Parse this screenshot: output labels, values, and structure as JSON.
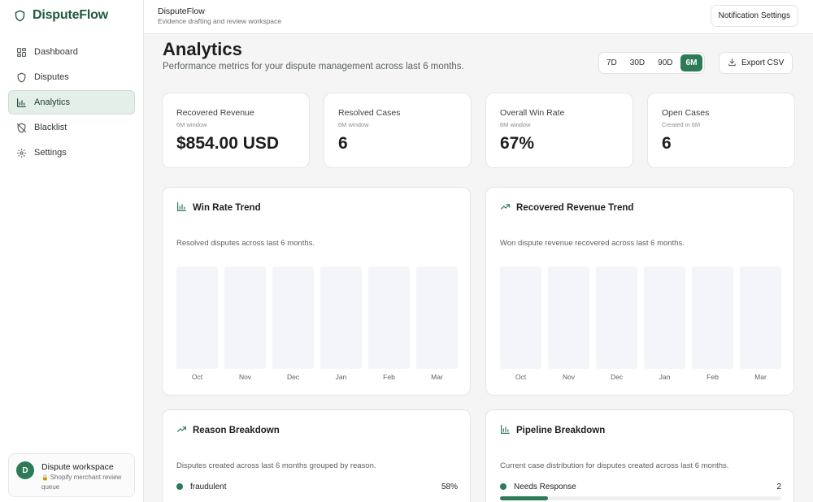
{
  "brand": {
    "name": "DisputeFlow"
  },
  "sidebar": {
    "items": [
      {
        "label": "Dashboard",
        "icon": "dashboard-icon",
        "active": false
      },
      {
        "label": "Disputes",
        "icon": "shield-icon",
        "active": false
      },
      {
        "label": "Analytics",
        "icon": "bar-chart-icon",
        "active": true
      },
      {
        "label": "Blacklist",
        "icon": "shield-off-icon",
        "active": false
      },
      {
        "label": "Settings",
        "icon": "gear-icon",
        "active": false
      }
    ],
    "workspace": {
      "avatar": "D",
      "name": "Dispute workspace",
      "subtitle": "Shopify merchant review queue"
    }
  },
  "topbar": {
    "title": "DisputeFlow",
    "subtitle": "Evidence drafting and review workspace",
    "notification_button": "Notification Settings"
  },
  "header": {
    "title": "Analytics",
    "subtitle": "Performance metrics for your dispute management across last 6 months.",
    "ranges": [
      "7D",
      "30D",
      "90D",
      "6M"
    ],
    "active_range": "6M",
    "export_label": "Export CSV"
  },
  "stats": [
    {
      "label": "Recovered Revenue",
      "hint": "6M window",
      "value": "$854.00 USD"
    },
    {
      "label": "Resolved Cases",
      "hint": "6M window",
      "value": "6"
    },
    {
      "label": "Overall Win Rate",
      "hint": "6M window",
      "value": "67%"
    },
    {
      "label": "Open Cases",
      "hint": "Created in 6M",
      "value": "6"
    }
  ],
  "panels": {
    "win_rate": {
      "title": "Win Rate Trend",
      "description": "Resolved disputes across last 6 months.",
      "months": [
        "Oct",
        "Nov",
        "Dec",
        "Jan",
        "Feb",
        "Mar"
      ]
    },
    "revenue": {
      "title": "Recovered Revenue Trend",
      "description": "Won dispute revenue recovered across last 6 months.",
      "months": [
        "Oct",
        "Nov",
        "Dec",
        "Jan",
        "Feb",
        "Mar"
      ]
    },
    "reason": {
      "title": "Reason Breakdown",
      "description": "Disputes created across last 6 months grouped by reason.",
      "rows": [
        {
          "label": "fraudulent",
          "value": "58%"
        }
      ]
    },
    "pipeline": {
      "title": "Pipeline Breakdown",
      "description": "Current case distribution for disputes created across last 6 months.",
      "rows": [
        {
          "label": "Needs Response",
          "value": "2",
          "progress": 0.17
        }
      ]
    }
  },
  "colors": {
    "accent": "#2d7a57",
    "brand": "#1f5a3c"
  }
}
